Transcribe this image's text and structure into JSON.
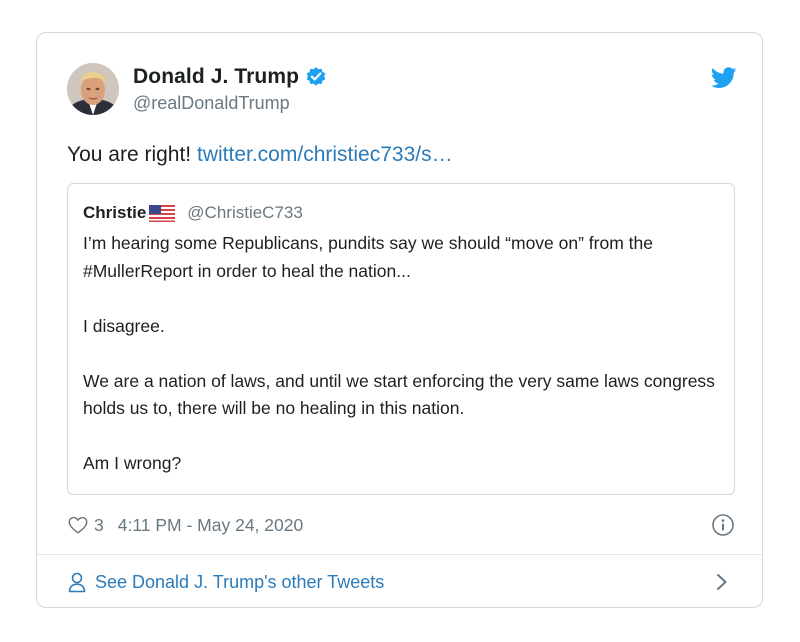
{
  "author": {
    "display_name": "Donald J. Trump",
    "handle": "@realDonaldTrump",
    "verified": true
  },
  "tweet": {
    "text": "You are right!",
    "link": "twitter.com/christiec733/s…"
  },
  "quoted": {
    "name": "Christie",
    "handle": "@ChristieC733",
    "paragraphs": [
      "I’m hearing some Republicans, pundits say we should “move on” from the #MullerReport in order to heal the nation...",
      "I disagree.",
      "We are a nation of laws, and until we start enforcing the very same laws congress holds us to, there will be no healing in this nation.",
      "Am I wrong?"
    ]
  },
  "meta": {
    "likes": "3",
    "timestamp": "4:11 PM - May 24, 2020"
  },
  "footer": {
    "label": "See Donald J. Trump's other Tweets"
  },
  "colors": {
    "link": "#2b7bb9",
    "verified": "#1da1f2",
    "muted": "#697882",
    "border": "#cfd9de"
  }
}
